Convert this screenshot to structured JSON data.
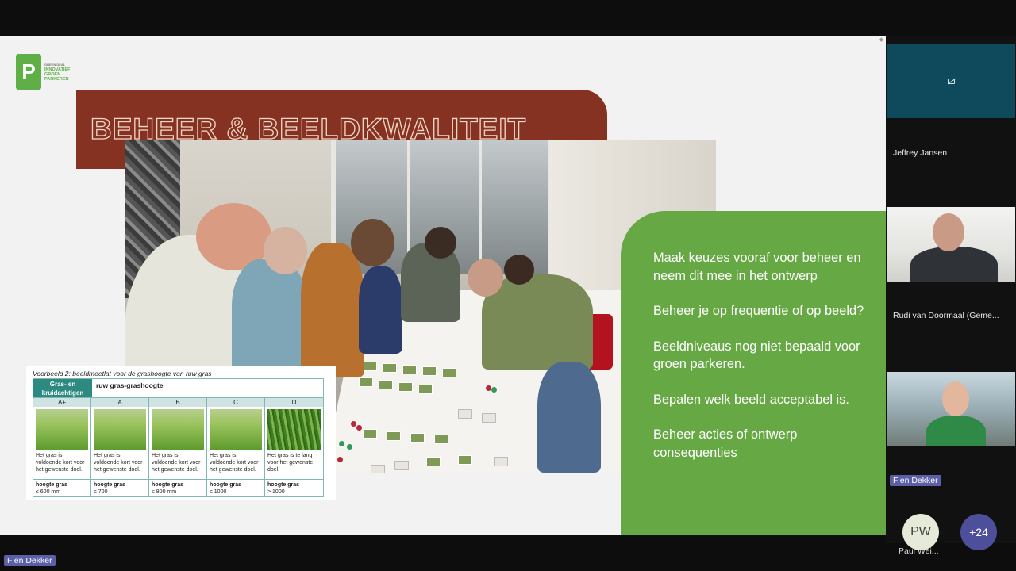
{
  "slide": {
    "logo": {
      "mark": "P",
      "small_line": "GREEN DEAL",
      "lines": [
        "INNOVATIEF",
        "GROEN",
        "PARKEREN"
      ]
    },
    "title": "BEHEER & BEELDKWALITEIT",
    "example": {
      "caption": "Voorbeeld 2: beeldmeetlat voor de grashoogte van ruw gras",
      "header_left": "Gras- en kruidachtigen",
      "header_right": "ruw gras-grashoogte",
      "columns": [
        {
          "grade": "A+",
          "text": "Het gras is voldoende kort voor het gewenste doel.",
          "label": "hoogte gras",
          "value": "≤ 600 mm"
        },
        {
          "grade": "A",
          "text": "Het gras is voldoende kort voor het gewenste doel.",
          "label": "hoogte gras",
          "value": "≤ 700"
        },
        {
          "grade": "B",
          "text": "Het gras is voldoende kort voor het gewenste doel.",
          "label": "hoogte gras",
          "value": "≤ 800 mm"
        },
        {
          "grade": "C",
          "text": "Het gras is voldoende kort voor het gewenste doel.",
          "label": "hoogte gras",
          "value": "≤ 1000"
        },
        {
          "grade": "D",
          "text": "Het gras is te lang voor het gewenste doel.",
          "label": "hoogte gras",
          "value": "> 1000"
        }
      ]
    },
    "bullets": [
      "Maak keuzes vooraf voor beheer en neem dit mee in het ontwerp",
      "Beheer je op frequentie of op beeld?",
      "Beeldniveaus nog niet bepaald voor groen parkeren.",
      "Bepalen welk beeld acceptabel is.",
      "Beheer acties of ontwerp consequenties"
    ]
  },
  "participants": {
    "tiles": [
      {
        "name": "Jeffrey Jansen",
        "icon": "camera-off-icon"
      },
      {
        "name": "Rudi van Doormaal (Geme..."
      },
      {
        "name": "Fien Dekker"
      }
    ],
    "avatar": {
      "initials": "PW",
      "name": "Paul Wei..."
    },
    "more": "+24"
  },
  "presenter": {
    "name": "Fien Dekker"
  },
  "colors": {
    "title_banner": "#863222",
    "bullet_panel": "#66a843",
    "logo_green": "#5fae46",
    "name_badge": "#5a5fa8",
    "teal_tile": "#0e4a5c"
  }
}
